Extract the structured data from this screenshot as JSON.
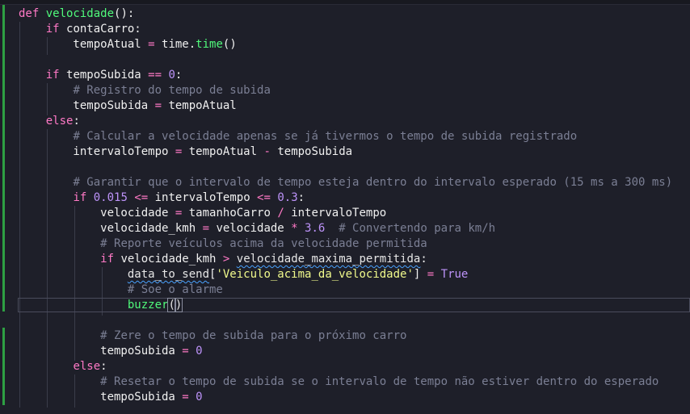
{
  "editor": {
    "colors": {
      "background": "#1e1f29",
      "keyword": "#ff79c6",
      "function": "#50fa7b",
      "number": "#bd93f9",
      "string": "#f1fa8c",
      "comment": "#7b7f94",
      "git_added": "#2ea043"
    },
    "lines": [
      {
        "tokens": [
          {
            "t": "kw",
            "v": "def "
          },
          {
            "t": "fn",
            "v": "velocidade"
          },
          {
            "t": "pn",
            "v": "():"
          }
        ]
      },
      {
        "tokens": [
          {
            "t": "id",
            "v": "    "
          },
          {
            "t": "kw",
            "v": "if "
          },
          {
            "t": "id",
            "v": "contaCarro:"
          }
        ]
      },
      {
        "tokens": [
          {
            "t": "id",
            "v": "        tempoAtual "
          },
          {
            "t": "op",
            "v": "="
          },
          {
            "t": "id",
            "v": " time."
          },
          {
            "t": "fn",
            "v": "time"
          },
          {
            "t": "pn",
            "v": "()"
          }
        ]
      },
      {
        "tokens": []
      },
      {
        "tokens": [
          {
            "t": "id",
            "v": "    "
          },
          {
            "t": "kw",
            "v": "if "
          },
          {
            "t": "id",
            "v": "tempoSubida "
          },
          {
            "t": "op",
            "v": "=="
          },
          {
            "t": "id",
            "v": " "
          },
          {
            "t": "num",
            "v": "0"
          },
          {
            "t": "pn",
            "v": ":"
          }
        ]
      },
      {
        "tokens": [
          {
            "t": "id",
            "v": "        "
          },
          {
            "t": "cm",
            "v": "# Registro do tempo de subida"
          }
        ]
      },
      {
        "tokens": [
          {
            "t": "id",
            "v": "        tempoSubida "
          },
          {
            "t": "op",
            "v": "="
          },
          {
            "t": "id",
            "v": " tempoAtual"
          }
        ]
      },
      {
        "tokens": [
          {
            "t": "id",
            "v": "    "
          },
          {
            "t": "kw",
            "v": "else"
          },
          {
            "t": "pn",
            "v": ":"
          }
        ]
      },
      {
        "tokens": [
          {
            "t": "id",
            "v": "        "
          },
          {
            "t": "cm",
            "v": "# Calcular a velocidade apenas se já tivermos o tempo de subida registrado"
          }
        ]
      },
      {
        "tokens": [
          {
            "t": "id",
            "v": "        intervaloTempo "
          },
          {
            "t": "op",
            "v": "="
          },
          {
            "t": "id",
            "v": " tempoAtual "
          },
          {
            "t": "op",
            "v": "-"
          },
          {
            "t": "id",
            "v": " tempoSubida"
          }
        ]
      },
      {
        "tokens": []
      },
      {
        "tokens": [
          {
            "t": "id",
            "v": "        "
          },
          {
            "t": "cm",
            "v": "# Garantir que o intervalo de tempo esteja dentro do intervalo esperado (15 ms a 300 ms)"
          }
        ]
      },
      {
        "tokens": [
          {
            "t": "id",
            "v": "        "
          },
          {
            "t": "kw",
            "v": "if "
          },
          {
            "t": "num",
            "v": "0.015"
          },
          {
            "t": "id",
            "v": " "
          },
          {
            "t": "op",
            "v": "<="
          },
          {
            "t": "id",
            "v": " intervaloTempo "
          },
          {
            "t": "op",
            "v": "<="
          },
          {
            "t": "id",
            "v": " "
          },
          {
            "t": "num",
            "v": "0.3"
          },
          {
            "t": "pn",
            "v": ":"
          }
        ]
      },
      {
        "tokens": [
          {
            "t": "id",
            "v": "            velocidade "
          },
          {
            "t": "op",
            "v": "="
          },
          {
            "t": "id",
            "v": " tamanhoCarro "
          },
          {
            "t": "op",
            "v": "/"
          },
          {
            "t": "id",
            "v": " intervaloTempo"
          }
        ]
      },
      {
        "tokens": [
          {
            "t": "id",
            "v": "            velocidade_kmh "
          },
          {
            "t": "op",
            "v": "="
          },
          {
            "t": "id",
            "v": " velocidade "
          },
          {
            "t": "op",
            "v": "*"
          },
          {
            "t": "id",
            "v": " "
          },
          {
            "t": "num",
            "v": "3.6"
          },
          {
            "t": "id",
            "v": "  "
          },
          {
            "t": "cm",
            "v": "# Convertendo para km/h"
          }
        ]
      },
      {
        "tokens": [
          {
            "t": "id",
            "v": "            "
          },
          {
            "t": "cm",
            "v": "# Reporte veículos acima da velocidade permitida"
          }
        ]
      },
      {
        "tokens": [
          {
            "t": "id",
            "v": "            "
          },
          {
            "t": "kw",
            "v": "if "
          },
          {
            "t": "id",
            "v": "velocidade_kmh "
          },
          {
            "t": "op",
            "v": ">"
          },
          {
            "t": "id",
            "v": " "
          },
          {
            "t": "sq",
            "v": "velocidade_maxima_permitida"
          },
          {
            "t": "pn",
            "v": ":"
          }
        ]
      },
      {
        "tokens": [
          {
            "t": "id",
            "v": "                "
          },
          {
            "t": "sq",
            "v": "data_to_send"
          },
          {
            "t": "pn",
            "v": "["
          },
          {
            "t": "str",
            "v": "'Veiculo_acima_da_velocidade'"
          },
          {
            "t": "pn",
            "v": "]"
          },
          {
            "t": "id",
            "v": " "
          },
          {
            "t": "op",
            "v": "="
          },
          {
            "t": "id",
            "v": " "
          },
          {
            "t": "bi",
            "v": "True"
          }
        ]
      },
      {
        "tokens": [
          {
            "t": "id",
            "v": "                "
          },
          {
            "t": "cm",
            "v": "# Soe o alarme"
          }
        ]
      },
      {
        "tokens": [
          {
            "t": "id",
            "v": "                "
          },
          {
            "t": "fn",
            "v": "buzzer"
          },
          {
            "t": "bm",
            "v": "("
          },
          {
            "t": "bm",
            "v": ")"
          }
        ]
      },
      {
        "tokens": []
      },
      {
        "tokens": [
          {
            "t": "id",
            "v": "            "
          },
          {
            "t": "cm",
            "v": "# Zere o tempo de subida para o próximo carro"
          }
        ]
      },
      {
        "tokens": [
          {
            "t": "id",
            "v": "            tempoSubida "
          },
          {
            "t": "op",
            "v": "="
          },
          {
            "t": "id",
            "v": " "
          },
          {
            "t": "num",
            "v": "0"
          }
        ]
      },
      {
        "tokens": [
          {
            "t": "id",
            "v": "        "
          },
          {
            "t": "kw",
            "v": "else"
          },
          {
            "t": "pn",
            "v": ":"
          }
        ]
      },
      {
        "tokens": [
          {
            "t": "id",
            "v": "            "
          },
          {
            "t": "cm",
            "v": "# Resetar o tempo de subida se o intervalo de tempo não estiver dentro do esperado"
          }
        ]
      },
      {
        "tokens": [
          {
            "t": "id",
            "v": "            tempoSubida "
          },
          {
            "t": "op",
            "v": "="
          },
          {
            "t": "id",
            "v": " "
          },
          {
            "t": "num",
            "v": "0"
          }
        ]
      }
    ]
  }
}
